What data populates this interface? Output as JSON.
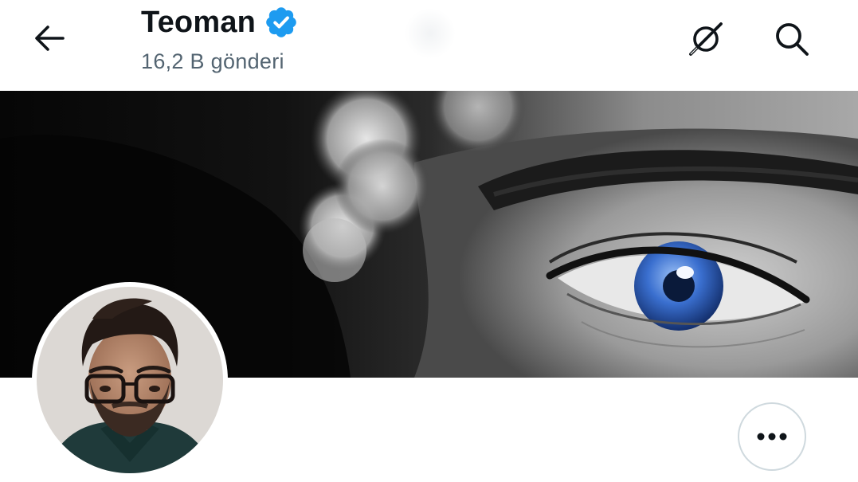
{
  "header": {
    "title": "Teoman",
    "post_count": "16,2 B gönderi",
    "verified": true
  },
  "icons": {
    "back": "arrow-left-icon",
    "verified": "verified-badge-icon",
    "grok": "grok-icon",
    "search": "search-icon",
    "more": "more-horizontal-icon"
  },
  "colors": {
    "verified_blue": "#1d9bf0",
    "text_primary": "#0f1419",
    "text_secondary": "#536471",
    "border": "#cfd9de",
    "eye_blue": "#3a6fcf"
  }
}
